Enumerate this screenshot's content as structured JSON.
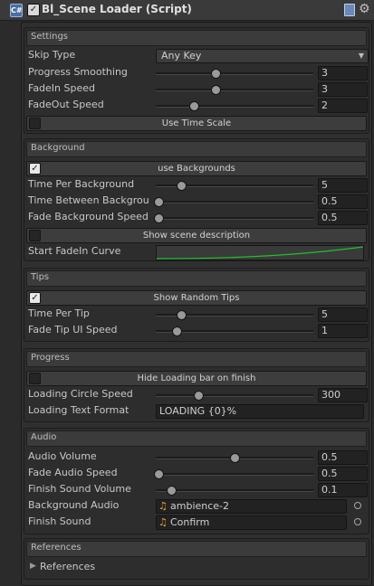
{
  "header": {
    "enabled_mark": "✓",
    "title": "Bl_Scene Loader (Script)"
  },
  "settings": {
    "heading": "Settings",
    "skip_type": {
      "label": "Skip Type",
      "value": "Any Key"
    },
    "progress_smoothing": {
      "label": "Progress Smoothing",
      "value": "3",
      "fraction": 0.38
    },
    "fadein_speed": {
      "label": "FadeIn Speed",
      "value": "3",
      "fraction": 0.38
    },
    "fadeout_speed": {
      "label": "FadeOut Speed",
      "value": "2",
      "fraction": 0.24
    },
    "use_time_scale": {
      "label": "Use Time Scale",
      "checked": false
    }
  },
  "background": {
    "heading": "Background",
    "use_backgrounds": {
      "label": "use Backgrounds",
      "checked": true
    },
    "time_per_background": {
      "label": "Time Per Background",
      "value": "5",
      "fraction": 0.16
    },
    "time_between_backgrounds": {
      "label": "Time Between Backgrou",
      "value": "0.5",
      "fraction": 0.02
    },
    "fade_background_speed": {
      "label": "Fade Background Speed",
      "value": "0.5",
      "fraction": 0.02
    },
    "show_scene_description": {
      "label": "Show scene description",
      "checked": false
    },
    "start_fadein_curve": {
      "label": "Start FadeIn Curve",
      "curve_color": "#22c02a"
    }
  },
  "tips": {
    "heading": "Tips",
    "show_random_tips": {
      "label": "Show Random Tips",
      "checked": true
    },
    "time_per_tip": {
      "label": "Time Per Tip",
      "value": "5",
      "fraction": 0.16
    },
    "fade_tip_ui_speed": {
      "label": "Fade Tip UI Speed",
      "value": "1",
      "fraction": 0.13
    }
  },
  "progress": {
    "heading": "Progress",
    "hide_loading_bar": {
      "label": "Hide Loading bar on finish",
      "checked": false
    },
    "loading_circle_speed": {
      "label": "Loading Circle Speed",
      "value": "300",
      "fraction": 0.27
    },
    "loading_text_format": {
      "label": "Loading Text Format",
      "value": "LOADING {0}%"
    }
  },
  "audio": {
    "heading": "Audio",
    "audio_volume": {
      "label": "Audio Volume",
      "value": "0.5",
      "fraction": 0.5
    },
    "fade_audio_speed": {
      "label": "Fade Audio Speed",
      "value": "0.5",
      "fraction": 0.02
    },
    "finish_sound_volume": {
      "label": "Finish Sound Volume",
      "value": "0.1",
      "fraction": 0.1
    },
    "background_audio": {
      "label": "Background Audio",
      "value": "ambience-2"
    },
    "finish_sound": {
      "label": "Finish Sound",
      "value": "Confirm"
    }
  },
  "references": {
    "heading": "References",
    "foldout_label": "References"
  },
  "colors": {
    "background": "#2b2b2b",
    "checkbox_on": "#e8e8e8",
    "audio_icon": "#e8a23a"
  },
  "icons": [
    "cs-script-icon",
    "help-book-icon",
    "gear-icon",
    "audio-clip-icon",
    "object-picker-icon",
    "foldout-arrow-icon"
  ]
}
